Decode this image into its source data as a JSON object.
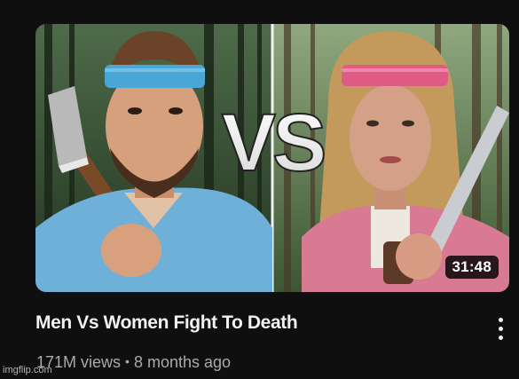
{
  "video": {
    "title": "Men Vs Women Fight To Death",
    "duration": "31:48",
    "views": "171M views",
    "separator": "•",
    "age": "8 months ago",
    "thumbnail_text": "VS"
  },
  "icons": {
    "more_actions": "kebab-vertical-icon"
  },
  "watermark": "imgflip.com",
  "colors": {
    "background": "#0f0f0f",
    "title": "#f1f1f1",
    "meta": "#aaaaaa",
    "duration_badge": "#000000"
  }
}
